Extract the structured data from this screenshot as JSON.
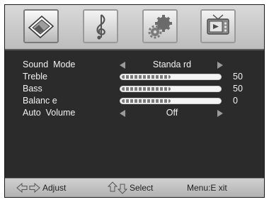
{
  "tabs": [
    {
      "icon": "picture-icon",
      "active": true
    },
    {
      "icon": "music-note-icon",
      "active": false
    },
    {
      "icon": "gears-icon",
      "active": false
    },
    {
      "icon": "tv-icon",
      "active": false
    }
  ],
  "menu": {
    "sound_mode": {
      "label": "Sound  Mode",
      "value": "Standa rd"
    },
    "treble": {
      "label": "Treble",
      "value": "50",
      "level": 50
    },
    "bass": {
      "label": "Bass",
      "value": "50",
      "level": 50
    },
    "balance": {
      "label": "Balanc e",
      "value": "0",
      "level": 50
    },
    "auto_volume": {
      "label": "Auto  Volume",
      "value": "Off"
    }
  },
  "footer": {
    "adjust_label": "Adjust",
    "select_label": "Select",
    "exit_label": "Menu:E xit"
  },
  "colors": {
    "panel": "#2b2b2b",
    "bars": "#c8c8c8",
    "text": "#f2f2f2"
  }
}
